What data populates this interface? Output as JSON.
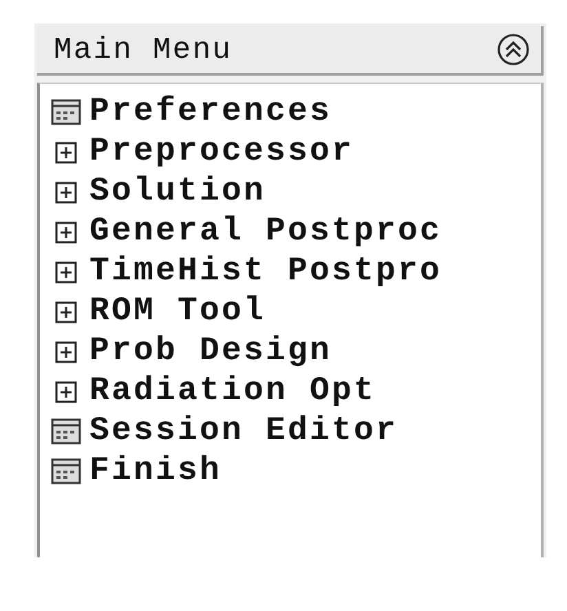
{
  "panel": {
    "title": "Main Menu"
  },
  "items": [
    {
      "label": "Preferences",
      "kind": "command"
    },
    {
      "label": "Preprocessor",
      "kind": "submenu"
    },
    {
      "label": "Solution",
      "kind": "submenu"
    },
    {
      "label": "General Postproc",
      "kind": "submenu"
    },
    {
      "label": "TimeHist Postpro",
      "kind": "submenu"
    },
    {
      "label": "ROM Tool",
      "kind": "submenu"
    },
    {
      "label": "Prob Design",
      "kind": "submenu"
    },
    {
      "label": "Radiation Opt",
      "kind": "submenu"
    },
    {
      "label": "Session Editor",
      "kind": "command"
    },
    {
      "label": "Finish",
      "kind": "command"
    }
  ]
}
